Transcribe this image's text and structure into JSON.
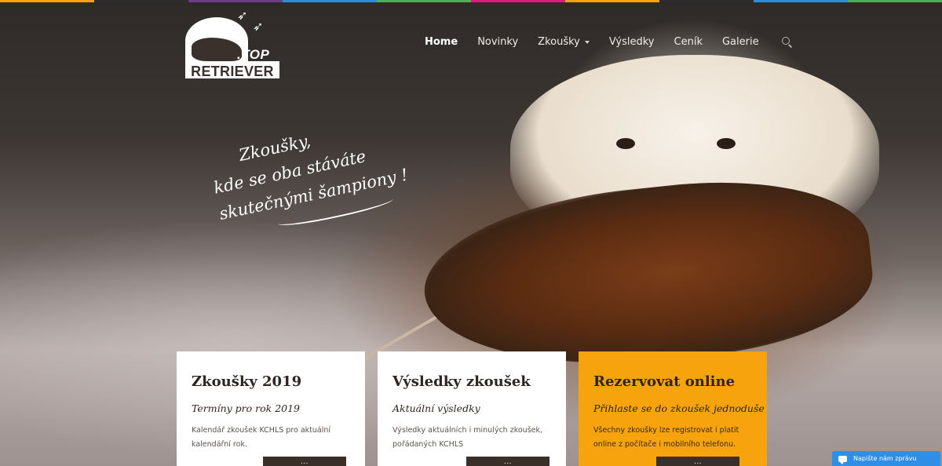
{
  "color_strip": [
    "#f6a30d",
    "#2c2c2c",
    "#6a3d91",
    "#2a8fd6",
    "#4caf50",
    "#e6177a",
    "#f6a30d",
    "#2c2c2c",
    "#2a8fd6",
    "#4caf50"
  ],
  "logo": {
    "top_word": ".TOP",
    "retriever_word": "RETRIEVER"
  },
  "nav": {
    "items": [
      {
        "label": "Home",
        "active": true
      },
      {
        "label": "Novinky"
      },
      {
        "label": "Zkoušky",
        "has_dropdown": true
      },
      {
        "label": "Výsledky"
      },
      {
        "label": "Ceník"
      },
      {
        "label": "Galerie"
      }
    ],
    "search_icon": "search-icon"
  },
  "slogan": {
    "line1": "Zkoušky,",
    "line2": "kde se oba stáváte",
    "line3": "skutečnými šampiony !"
  },
  "cards": [
    {
      "title": "Zkoušky 2019",
      "subtitle": "Termíny pro rok 2019",
      "description": "Kalendář zkoušek KCHLS pro aktuální kalendářní rok.",
      "button": "...",
      "style": "white"
    },
    {
      "title": "Výsledky zkoušek",
      "subtitle": "Aktuální výsledky",
      "description": "Výsledky aktuálních i minulých zkoušek, pořádaných KCHLS",
      "button": "...",
      "style": "white"
    },
    {
      "title": "Rezervovat online",
      "subtitle": "Přihlaste se do zkoušek jednoduše",
      "description": "Všechny zkoušky lze registrovat i platit online z počítače i mobilního telefonu.",
      "button": "...",
      "style": "orange"
    }
  ],
  "chat": {
    "label": "Napište nám zprávu",
    "icon": "chat-bubble-icon",
    "color": "#2f8ee6"
  },
  "colors": {
    "accent": "#f6a30d",
    "dark": "#3a2f29"
  }
}
